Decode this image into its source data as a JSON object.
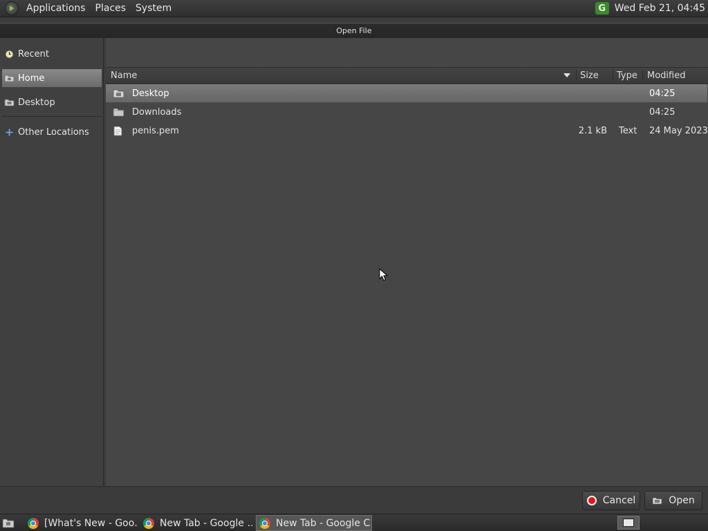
{
  "top_panel": {
    "menus": [
      "Applications",
      "Places",
      "System"
    ],
    "tray_icon": "G",
    "clock": "Wed Feb 21, 04:45"
  },
  "dialog": {
    "title": "Open File"
  },
  "sidebar": {
    "items": [
      {
        "label": "Recent",
        "icon": "recent-clock-icon"
      },
      {
        "label": "Home",
        "icon": "home-folder-icon",
        "selected": true
      },
      {
        "label": "Desktop",
        "icon": "desktop-folder-icon"
      },
      {
        "label": "Other Locations",
        "icon": "plus-icon"
      }
    ]
  },
  "file_list": {
    "columns": {
      "name": "Name",
      "size": "Size",
      "type": "Type",
      "modified": "Modified"
    },
    "sort_column": "Name",
    "rows": [
      {
        "name": "Desktop",
        "size": "",
        "type": "",
        "modified": "04:25",
        "icon": "desktop-folder-icon",
        "selected": true
      },
      {
        "name": "Downloads",
        "size": "",
        "type": "",
        "modified": "04:25",
        "icon": "folder-icon"
      },
      {
        "name": "penis.pem",
        "size": "2.1 kB",
        "type": "Text",
        "modified": "24 May 2023",
        "icon": "text-file-icon"
      }
    ]
  },
  "buttons": {
    "cancel": "Cancel",
    "open": "Open"
  },
  "taskbar": {
    "tasks": [
      {
        "label": "[What's New - Goo…",
        "active": false
      },
      {
        "label": "New Tab - Google …",
        "active": false
      },
      {
        "label": "New Tab - Google C…",
        "active": true
      }
    ]
  },
  "colors": {
    "selection": "#707070",
    "cancel_red": "#e0161a",
    "tray_green": "#3b8b2c"
  }
}
